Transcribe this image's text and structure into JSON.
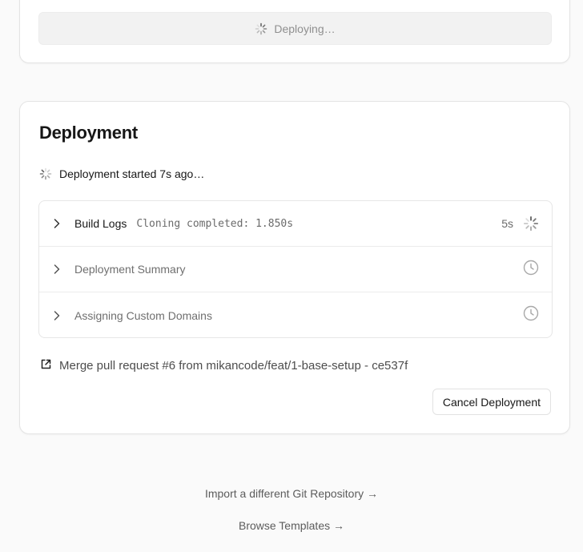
{
  "top_card": {
    "deploy_button_label": "Deploying…"
  },
  "deployment": {
    "title": "Deployment",
    "status_text": "Deployment started 7s ago…",
    "steps": [
      {
        "label": "Build Logs",
        "log": "Cloning completed: 1.850s",
        "duration": "5s",
        "state": "running",
        "icon": "spinner-icon"
      },
      {
        "label": "Deployment Summary",
        "state": "pending",
        "icon": "clock-icon"
      },
      {
        "label": "Assigning Custom Domains",
        "state": "pending",
        "icon": "clock-icon"
      }
    ],
    "commit_message": "Merge pull request #6 from mikancode/feat/1-base-setup - ce537f",
    "commit_icon": "external-link-icon",
    "cancel_label": "Cancel Deployment"
  },
  "footer": {
    "import_link": "Import a different Git Repository →",
    "templates_link": "Browse Templates →"
  },
  "colors": {
    "background": "#fafafa",
    "card": "#ffffff",
    "border": "#e4e4e4",
    "muted_text": "#6f6f6f",
    "button_disabled": "#f2f2f2"
  }
}
